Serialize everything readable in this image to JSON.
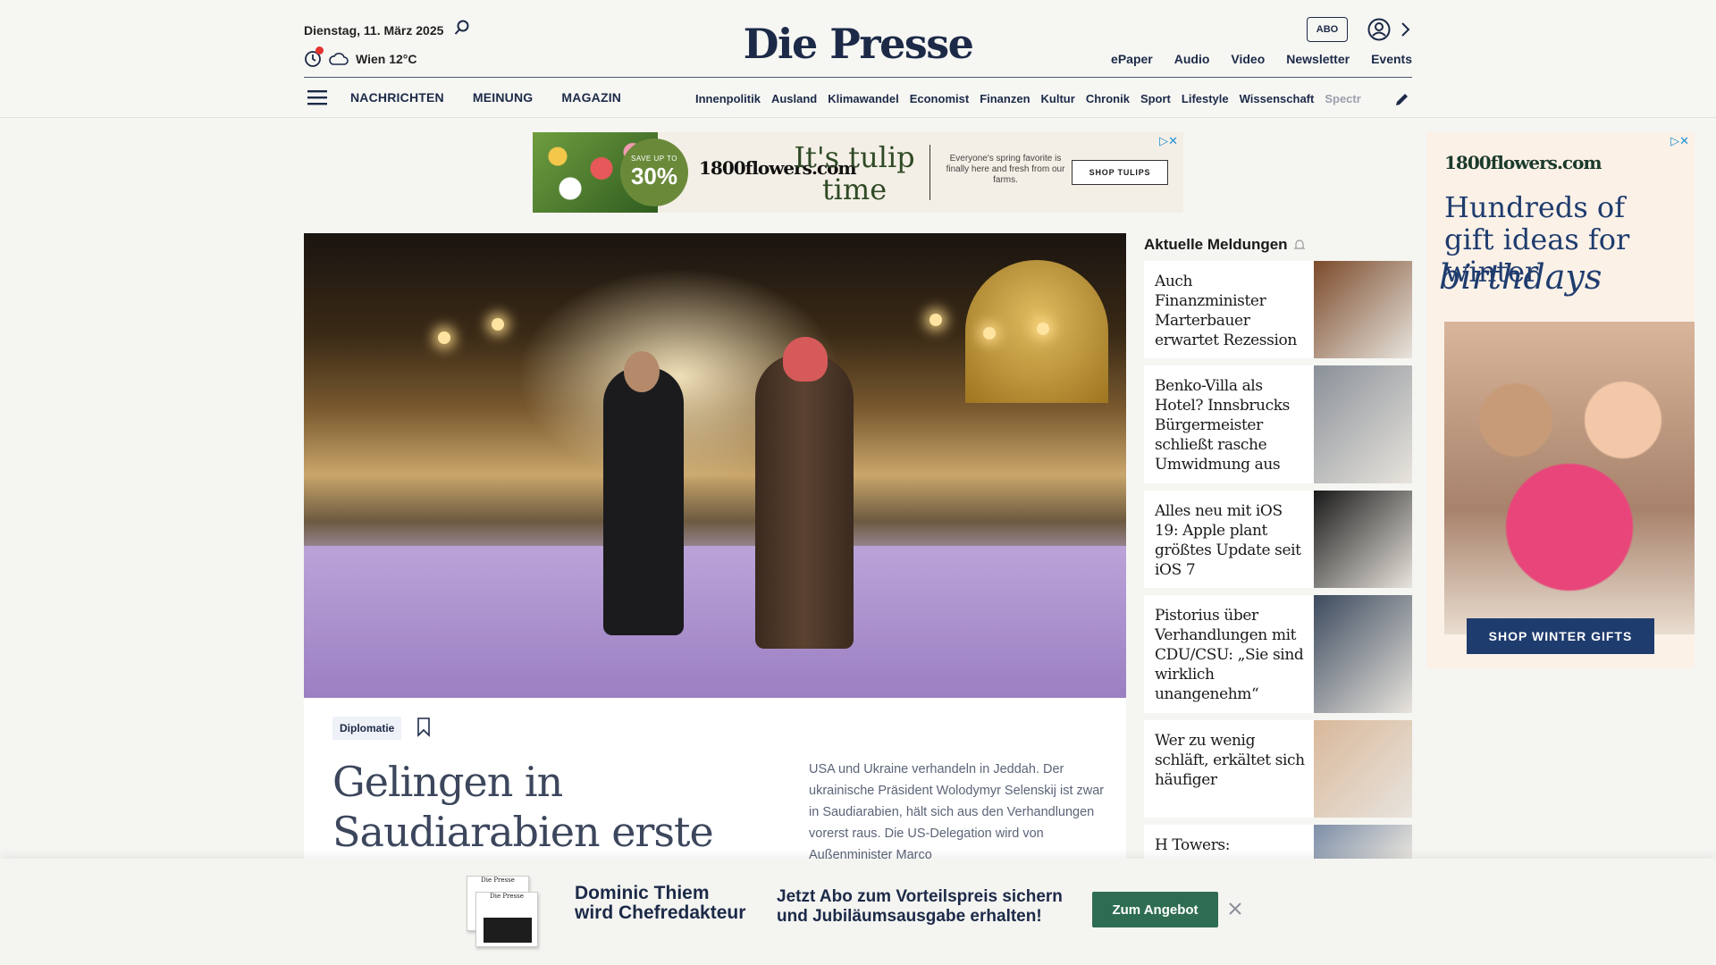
{
  "header": {
    "date": "Dienstag, 11. März 2025",
    "weather": "Wien 12°C",
    "logo": "Die Presse",
    "abo_label": "ABO",
    "utility_links": [
      "ePaper",
      "Audio",
      "Video",
      "Newsletter",
      "Events"
    ]
  },
  "nav": {
    "main": [
      "NACHRICHTEN",
      "MEINUNG",
      "MAGAZIN"
    ],
    "sections": [
      "Innenpolitik",
      "Ausland",
      "Klimawandel",
      "Economist",
      "Finanzen",
      "Kultur",
      "Chronik",
      "Sport",
      "Lifestyle",
      "Wissenschaft",
      "Spectr"
    ]
  },
  "ad_banner": {
    "badge_small": "SAVE UP TO",
    "badge_big": "30%",
    "brand": "1800flowers.com",
    "headline_line1": "It's tulip",
    "headline_line2": "time",
    "copy": "Everyone's spring favorite is finally here and fresh from our farms.",
    "cta": "SHOP TULIPS",
    "choice": "▷✕"
  },
  "article": {
    "tag": "Diplomatie",
    "title": "Gelingen in Saudiarabien erste",
    "teaser": "USA und Ukraine verhandeln in Jeddah. Der ukrainische Präsident Wolodymyr Selenskij ist zwar in Saudiarabien, hält sich aus den Verhandlungen vorerst raus. Die US-Delegation wird von Außenminister Marco"
  },
  "sidebar": {
    "title": "Aktuelle Meldungen",
    "items": [
      {
        "title": "Auch Finanzminister Marterbauer erwartet Rezession",
        "thumb_color": "#7b4a2a"
      },
      {
        "title": "Benko-Villa als Hotel? Innsbrucks Bürgermeister schließt rasche Umwidmung aus",
        "thumb_color": "#8a9098"
      },
      {
        "title": "Alles neu mit iOS 19: Apple plant größtes Update seit iOS 7",
        "thumb_color": "#1a1a1a"
      },
      {
        "title": "Pistorius über Verhandlungen mit CDU/CSU: „Sie sind wirklich unangenehm“",
        "thumb_color": "#3c4a5e"
      },
      {
        "title": "Wer zu wenig schläft, erkältet sich häufiger",
        "thumb_color": "#d9b89a"
      },
      {
        "title": "H Towers:",
        "thumb_color": "#7c8ea8"
      }
    ]
  },
  "ad_sky": {
    "brand": "1800flowers.com",
    "headline": "Hundreds of gift ideas for winter",
    "script": "birthdays",
    "cta": "SHOP WINTER GIFTS",
    "choice": "▷✕"
  },
  "bottom_bar": {
    "name_line1": "Dominic Thiem",
    "name_line2": "wird Chefredakteur",
    "offer_line1": "Jetzt Abo zum Vorteilspreis sichern",
    "offer_line2": "und Jubiläumsausgabe erhalten!",
    "cta": "Zum Angebot",
    "paper_label": "Die Presse"
  }
}
